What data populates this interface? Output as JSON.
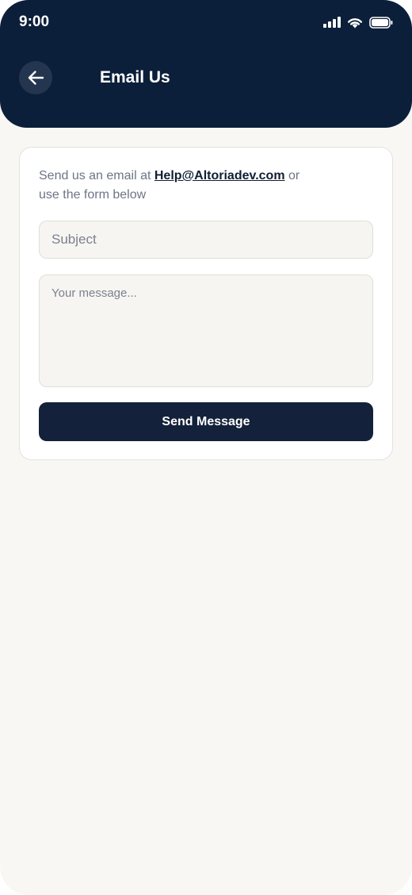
{
  "status_bar": {
    "time": "9:00",
    "icons": [
      "cellular-signal-icon",
      "wifi-icon",
      "battery-icon"
    ]
  },
  "header": {
    "back_icon": "arrow-left-icon",
    "title": "Email Us"
  },
  "form": {
    "intro_before": "Send us an email at ",
    "email": "Help@Altoriadev.com",
    "intro_after": " or use the form below",
    "subject_placeholder": "Subject",
    "message_placeholder": "Your message...",
    "send_label": "Send Message"
  },
  "colors": {
    "header_bg": "#0c1f3a",
    "page_bg": "#f8f7f4",
    "button_bg": "#13213a",
    "input_bg": "#f6f5f1"
  }
}
